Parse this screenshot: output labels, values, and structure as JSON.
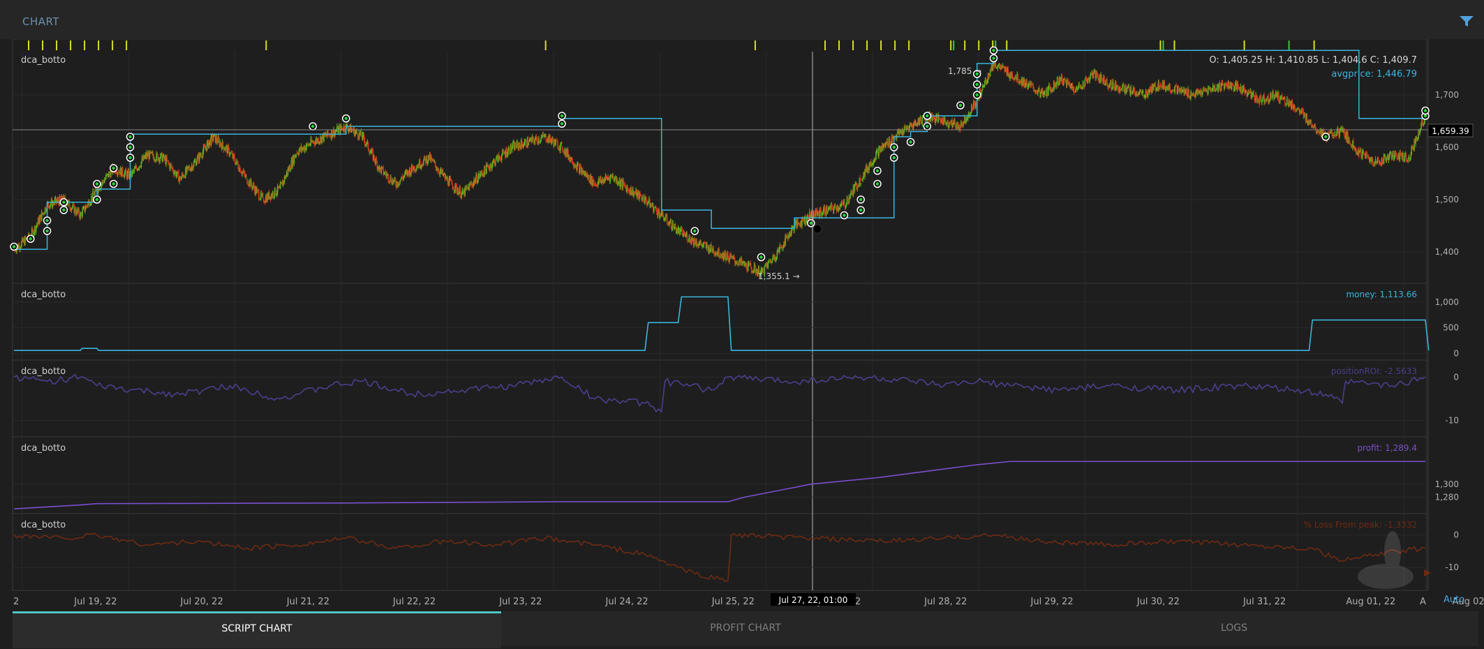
{
  "header": {
    "title": "CHART",
    "filter_icon": "filter-icon"
  },
  "ohlc_readout": "O: 1,405.25 H: 1,410.85 L: 1,404.6 C: 1,409.7",
  "auto_label": "Auto",
  "crosshair_label": "Jul 27, 22, 01:00",
  "colors": {
    "background": "#1e1e1e",
    "candle_up": "#5fb21c",
    "candle_down": "#d2381c",
    "avgprice": "#3cb5dc",
    "money": "#3cb5dc",
    "roi": "#4b3f8e",
    "profit": "#7b4fd0",
    "drawdown": "#6e2a12",
    "marker_yellow": "#d9e021",
    "marker_green": "#27d43a",
    "tab_accent": "#4fc6c4"
  },
  "tabs": [
    {
      "label": "SCRIPT CHART",
      "active": true
    },
    {
      "label": "PROFIT CHART",
      "active": false
    },
    {
      "label": "LOGS",
      "active": false
    }
  ],
  "x_axis": {
    "labels": [
      "Jul 19, 22",
      "Jul 20, 22",
      "Jul 21, 22",
      "Jul 22, 22",
      "Jul 23, 22",
      "Jul 24, 22",
      "Jul 25, 22",
      "Jul 26, 22",
      "Jul 28, 22",
      "Jul 29, 22",
      "Jul 30, 22",
      "Jul 31, 22",
      "Aug 01, 22",
      "Aug 02, 22"
    ],
    "left_edge_fragment": "2",
    "right_edge_fragment": "A"
  },
  "chart_data": [
    {
      "type": "candlestick",
      "panel_label": "dca_botto",
      "ylim": [
        1340,
        1780
      ],
      "ticks": [
        "1,400",
        "1,500",
        "1,600",
        "1,700"
      ],
      "current_price_label": "1,659.39",
      "series": [
        {
          "name": "avgprice",
          "last_value_label": "avgprice: 1,446.79"
        }
      ],
      "annotations": [
        {
          "text": "1,785",
          "kind": "high"
        },
        {
          "text": "1,355.1",
          "kind": "low"
        }
      ],
      "price_path": [
        [
          0,
          1405
        ],
        [
          1,
          1430
        ],
        [
          2,
          1490
        ],
        [
          3,
          1500
        ],
        [
          4,
          1470
        ],
        [
          5,
          1520
        ],
        [
          6,
          1560
        ],
        [
          7,
          1545
        ],
        [
          8,
          1585
        ],
        [
          9,
          1580
        ],
        [
          10,
          1540
        ],
        [
          11,
          1575
        ],
        [
          12,
          1620
        ],
        [
          13,
          1590
        ],
        [
          14,
          1540
        ],
        [
          15,
          1500
        ],
        [
          16,
          1520
        ],
        [
          17,
          1590
        ],
        [
          18,
          1610
        ],
        [
          19,
          1625
        ],
        [
          20,
          1640
        ],
        [
          21,
          1620
        ],
        [
          22,
          1560
        ],
        [
          23,
          1530
        ],
        [
          24,
          1560
        ],
        [
          25,
          1580
        ],
        [
          26,
          1540
        ],
        [
          27,
          1510
        ],
        [
          28,
          1545
        ],
        [
          29,
          1575
        ],
        [
          30,
          1600
        ],
        [
          31,
          1610
        ],
        [
          32,
          1620
        ],
        [
          33,
          1600
        ],
        [
          34,
          1560
        ],
        [
          35,
          1530
        ],
        [
          36,
          1545
        ],
        [
          37,
          1520
        ],
        [
          38,
          1500
        ],
        [
          39,
          1470
        ],
        [
          40,
          1440
        ],
        [
          41,
          1420
        ],
        [
          42,
          1405
        ],
        [
          43,
          1390
        ],
        [
          44,
          1375
        ],
        [
          45,
          1360
        ],
        [
          46,
          1400
        ],
        [
          47,
          1450
        ],
        [
          48,
          1470
        ],
        [
          49,
          1480
        ],
        [
          50,
          1490
        ],
        [
          51,
          1540
        ],
        [
          52,
          1590
        ],
        [
          53,
          1620
        ],
        [
          54,
          1640
        ],
        [
          55,
          1660
        ],
        [
          56,
          1650
        ],
        [
          57,
          1640
        ],
        [
          58,
          1690
        ],
        [
          59,
          1760
        ],
        [
          60,
          1740
        ],
        [
          61,
          1720
        ],
        [
          62,
          1700
        ],
        [
          63,
          1730
        ],
        [
          64,
          1710
        ],
        [
          65,
          1740
        ],
        [
          66,
          1720
        ],
        [
          67,
          1710
        ],
        [
          68,
          1700
        ],
        [
          69,
          1720
        ],
        [
          70,
          1710
        ],
        [
          71,
          1700
        ],
        [
          72,
          1710
        ],
        [
          73,
          1720
        ],
        [
          74,
          1710
        ],
        [
          75,
          1690
        ],
        [
          76,
          1700
        ],
        [
          77,
          1680
        ],
        [
          78,
          1650
        ],
        [
          79,
          1620
        ],
        [
          80,
          1630
        ],
        [
          81,
          1590
        ],
        [
          82,
          1570
        ],
        [
          83,
          1585
        ],
        [
          84,
          1580
        ],
        [
          85,
          1660
        ]
      ],
      "avgprice_steps": [
        [
          0,
          1405
        ],
        [
          2,
          1495
        ],
        [
          5,
          1520
        ],
        [
          7,
          1625
        ],
        [
          18,
          1625
        ],
        [
          20,
          1640
        ],
        [
          33,
          1655
        ],
        [
          38,
          1655
        ],
        [
          39,
          1480
        ],
        [
          42,
          1445
        ],
        [
          46,
          1445
        ],
        [
          47,
          1465
        ],
        [
          51,
          1465
        ],
        [
          53,
          1620
        ],
        [
          54,
          1630
        ],
        [
          55,
          1660
        ],
        [
          58,
          1760
        ],
        [
          59,
          1785
        ],
        [
          80,
          1785
        ],
        [
          81,
          1655
        ],
        [
          85,
          1655
        ]
      ],
      "trade_markers": [
        [
          0,
          1410
        ],
        [
          1,
          1425
        ],
        [
          2,
          1440
        ],
        [
          2,
          1460
        ],
        [
          3,
          1480
        ],
        [
          3,
          1495
        ],
        [
          5,
          1500
        ],
        [
          5,
          1530
        ],
        [
          6,
          1530
        ],
        [
          6,
          1560
        ],
        [
          7,
          1580
        ],
        [
          7,
          1600
        ],
        [
          7,
          1620
        ],
        [
          18,
          1640
        ],
        [
          20,
          1655
        ],
        [
          33,
          1645
        ],
        [
          33,
          1660
        ],
        [
          41,
          1440
        ],
        [
          45,
          1390
        ],
        [
          48,
          1455
        ],
        [
          50,
          1470
        ],
        [
          51,
          1480
        ],
        [
          51,
          1500
        ],
        [
          52,
          1530
        ],
        [
          52,
          1555
        ],
        [
          53,
          1580
        ],
        [
          53,
          1600
        ],
        [
          54,
          1610
        ],
        [
          55,
          1640
        ],
        [
          55,
          1660
        ],
        [
          57,
          1680
        ],
        [
          58,
          1700
        ],
        [
          58,
          1720
        ],
        [
          58,
          1740
        ],
        [
          59,
          1770
        ],
        [
          59,
          1785
        ],
        [
          79,
          1620
        ],
        [
          85,
          1660
        ],
        [
          85,
          1670
        ]
      ]
    },
    {
      "type": "line",
      "panel_label": "dca_botto",
      "ylim": [
        -60,
        1200
      ],
      "ticks": [
        "1,000",
        "500",
        "0"
      ],
      "series": [
        {
          "name": "money",
          "last_value_label": "money: 1,113.66"
        }
      ],
      "points": [
        [
          0,
          60
        ],
        [
          4,
          60
        ],
        [
          4.1,
          100
        ],
        [
          5,
          100
        ],
        [
          5.1,
          60
        ],
        [
          38,
          60
        ],
        [
          38.2,
          600
        ],
        [
          40,
          600
        ],
        [
          40.2,
          1100
        ],
        [
          43,
          1100
        ],
        [
          43.2,
          60
        ],
        [
          78,
          60
        ],
        [
          78.2,
          650
        ],
        [
          85,
          650
        ],
        [
          85.2,
          60
        ]
      ]
    },
    {
      "type": "line",
      "panel_label": "dca_botto",
      "ylim": [
        -13,
        2
      ],
      "ticks": [
        "0",
        "-10"
      ],
      "series": [
        {
          "name": "positionROI",
          "last_value_label": "positionROI: -2.5633"
        }
      ],
      "points": [
        [
          0,
          0
        ],
        [
          2,
          -1
        ],
        [
          4,
          0
        ],
        [
          5,
          -2
        ],
        [
          7,
          -3
        ],
        [
          10,
          -4
        ],
        [
          13,
          -2
        ],
        [
          16,
          -5
        ],
        [
          19,
          -2
        ],
        [
          21,
          -1
        ],
        [
          24,
          -4
        ],
        [
          27,
          -3
        ],
        [
          30,
          -2
        ],
        [
          33,
          0
        ],
        [
          35,
          -5
        ],
        [
          38,
          -6
        ],
        [
          39,
          -8
        ],
        [
          39.2,
          -1
        ],
        [
          42,
          -3
        ],
        [
          43,
          0
        ],
        [
          47,
          -1
        ],
        [
          51,
          0
        ],
        [
          54,
          -1
        ],
        [
          56,
          -2
        ],
        [
          58,
          -1
        ],
        [
          60,
          -2
        ],
        [
          63,
          -3
        ],
        [
          66,
          -2
        ],
        [
          70,
          -3
        ],
        [
          74,
          -2
        ],
        [
          77,
          -3
        ],
        [
          79,
          -4
        ],
        [
          80,
          -6
        ],
        [
          80.2,
          -1
        ],
        [
          83,
          -2
        ],
        [
          85,
          0
        ]
      ]
    },
    {
      "type": "line",
      "panel_label": "dca_botto",
      "ylim": [
        1260,
        1360
      ],
      "ticks": [
        "1,300",
        "1,280"
      ],
      "series": [
        {
          "name": "profit",
          "last_value_label": "profit: 1,289.4"
        }
      ],
      "points": [
        [
          0,
          1262
        ],
        [
          4,
          1268
        ],
        [
          5,
          1270
        ],
        [
          20,
          1271
        ],
        [
          33,
          1273
        ],
        [
          43,
          1273
        ],
        [
          44,
          1280
        ],
        [
          46,
          1290
        ],
        [
          48,
          1300
        ],
        [
          52,
          1310
        ],
        [
          55,
          1320
        ],
        [
          58,
          1330
        ],
        [
          60,
          1335
        ],
        [
          85,
          1335
        ]
      ]
    },
    {
      "type": "line",
      "panel_label": "dca_botto",
      "ylim": [
        -16,
        4
      ],
      "ticks": [
        "0",
        "-10"
      ],
      "series": [
        {
          "name": "% Loss From peak",
          "last_value_label": "% Loss From peak: -1.3332"
        }
      ],
      "points": [
        [
          0,
          0
        ],
        [
          3,
          -1
        ],
        [
          5,
          0
        ],
        [
          8,
          -3
        ],
        [
          11,
          -2
        ],
        [
          14,
          -4
        ],
        [
          17,
          -3
        ],
        [
          20,
          -1
        ],
        [
          23,
          -4
        ],
        [
          26,
          -2
        ],
        [
          29,
          -3
        ],
        [
          32,
          -1
        ],
        [
          35,
          -3
        ],
        [
          38,
          -6
        ],
        [
          41,
          -12
        ],
        [
          43,
          -14
        ],
        [
          43.2,
          0
        ],
        [
          48,
          -1
        ],
        [
          52,
          -2
        ],
        [
          56,
          -1
        ],
        [
          59,
          0
        ],
        [
          62,
          -2
        ],
        [
          66,
          -3
        ],
        [
          70,
          -2
        ],
        [
          74,
          -3
        ],
        [
          78,
          -4
        ],
        [
          80,
          -8
        ],
        [
          82,
          -6
        ],
        [
          85,
          -4
        ]
      ]
    }
  ],
  "signal_strip": {
    "yellow": [
      1,
      2,
      3,
      4,
      5,
      6,
      7,
      8,
      18,
      38,
      53,
      58,
      59,
      60,
      61,
      62,
      63,
      64,
      67,
      68,
      69,
      70,
      71,
      82,
      83,
      88,
      93
    ],
    "green": [
      67,
      70,
      82,
      91
    ]
  },
  "watermark_icon": "rabbit-logo-icon"
}
